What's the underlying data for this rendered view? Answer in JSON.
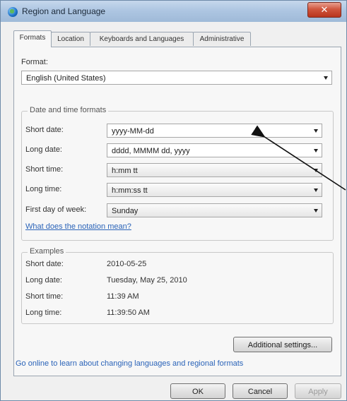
{
  "window": {
    "title": "Region and Language",
    "close_glyph": "✕"
  },
  "tabs": [
    {
      "label": "Formats",
      "active": true
    },
    {
      "label": "Location"
    },
    {
      "label": "Keyboards and Languages"
    },
    {
      "label": "Administrative"
    }
  ],
  "format": {
    "label": "Format:",
    "value": "English (United States)"
  },
  "date_time": {
    "legend": "Date and time formats",
    "rows": [
      {
        "label": "Short date:",
        "value": "yyyy-MM-dd"
      },
      {
        "label": "Long date:",
        "value": "dddd, MMMM dd, yyyy"
      },
      {
        "label": "Short time:",
        "value": "h:mm tt"
      },
      {
        "label": "Long time:",
        "value": "h:mm:ss tt"
      },
      {
        "label": "First day of week:",
        "value": "Sunday"
      }
    ],
    "notation_link": "What does the notation mean?"
  },
  "examples": {
    "legend": "Examples",
    "rows": [
      {
        "label": "Short date:",
        "value": "2010-05-25"
      },
      {
        "label": "Long date:",
        "value": "Tuesday, May 25, 2010"
      },
      {
        "label": "Short time:",
        "value": "11:39 AM"
      },
      {
        "label": "Long time:",
        "value": "11:39:50 AM"
      }
    ]
  },
  "additional_settings": "Additional settings...",
  "online_link": "Go online to learn about changing languages and regional formats",
  "buttons": {
    "ok": "OK",
    "cancel": "Cancel",
    "apply": "Apply"
  },
  "colors": {
    "link": "#2a63b8",
    "close": "#c8452c",
    "titlebar": "#aec6e2"
  }
}
